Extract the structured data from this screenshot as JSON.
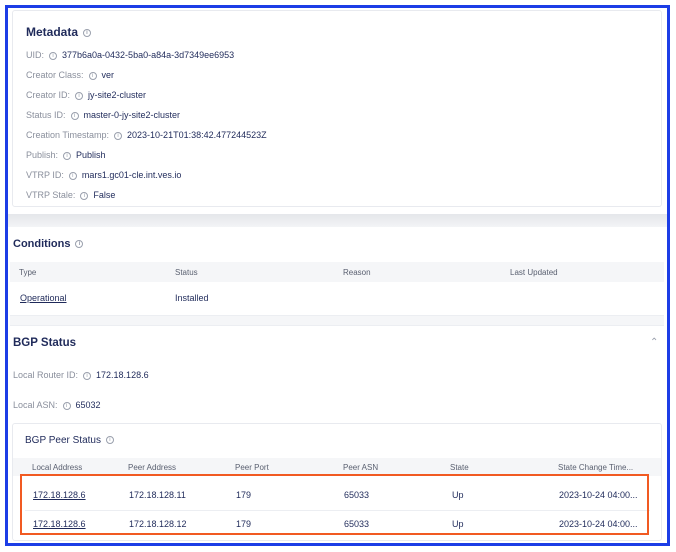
{
  "metadata": {
    "title": "Metadata",
    "fields": [
      {
        "label": "UID:",
        "value": "377b6a0a-0432-5ba0-a84a-3d7349ee6953"
      },
      {
        "label": "Creator Class:",
        "value": "ver"
      },
      {
        "label": "Creator ID:",
        "value": "jy-site2-cluster"
      },
      {
        "label": "Status ID:",
        "value": "master-0-jy-site2-cluster"
      },
      {
        "label": "Creation Timestamp:",
        "value": "2023-10-21T01:38:42.477244523Z"
      },
      {
        "label": "Publish:",
        "value": "Publish"
      },
      {
        "label": "VTRP ID:",
        "value": "mars1.gc01-cle.int.ves.io"
      },
      {
        "label": "VTRP Stale:",
        "value": "False"
      }
    ]
  },
  "conditions": {
    "title": "Conditions",
    "headers": [
      "Type",
      "Status",
      "Reason",
      "Last Updated"
    ],
    "rows": [
      {
        "type": "Operational",
        "status": "Installed",
        "reason": "",
        "last_updated": ""
      }
    ]
  },
  "bgp": {
    "title": "BGP Status",
    "local_router_id_label": "Local Router ID:",
    "local_router_id": "172.18.128.6",
    "local_asn_label": "Local ASN:",
    "local_asn": "65032",
    "peer_status": {
      "title": "BGP Peer Status",
      "headers": [
        "Local Address",
        "Peer Address",
        "Peer Port",
        "Peer ASN",
        "State",
        "State Change Time..."
      ],
      "rows": [
        {
          "local": "172.18.128.6",
          "peer": "172.18.128.11",
          "port": "179",
          "asn": "65033",
          "state": "Up",
          "time": "2023-10-24 04:00..."
        },
        {
          "local": "172.18.128.6",
          "peer": "172.18.128.12",
          "port": "179",
          "asn": "65033",
          "state": "Up",
          "time": "2023-10-24 04:00..."
        }
      ]
    }
  },
  "colors": {
    "frame": "#1c3de6",
    "highlight": "#f15a22"
  }
}
